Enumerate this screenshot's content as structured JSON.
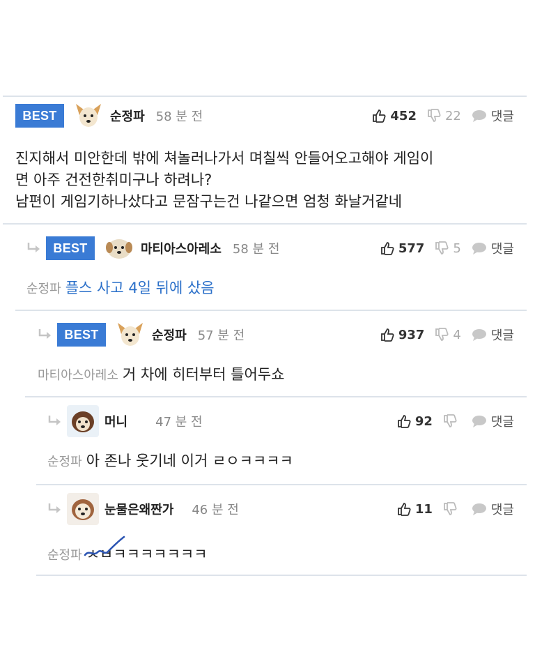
{
  "comments": [
    {
      "best": "BEST",
      "author": "순정파",
      "time": "58 분 전",
      "likes": "452",
      "dislikes": "22",
      "reply_label": "댓글",
      "body_lines": [
        "진지해서 미안한데 밖에 쳐놀러나가서 며칠씩 안들어오고해야 게임이",
        "면 아주 건전한취미구나 하려나?",
        "남편이 게임기하나샀다고 문잠구는건 나같으면 엄청 화날거같네"
      ]
    },
    {
      "best": "BEST",
      "author": "마티아스아레소",
      "time": "58 분 전",
      "likes": "577",
      "dislikes": "5",
      "reply_label": "댓글",
      "mention": "순정파",
      "body": "플스 사고 4일 뒤에 샀음"
    },
    {
      "best": "BEST",
      "author": "순정파",
      "time": "57 분 전",
      "likes": "937",
      "dislikes": "4",
      "reply_label": "댓글",
      "mention": "마티아스아레소",
      "body": "거 차에 히터부터 틀어두쇼"
    },
    {
      "author": "머니",
      "time": "47 분 전",
      "likes": "92",
      "dislikes": "",
      "reply_label": "댓글",
      "mention": "순정파",
      "body": "아 존나 웃기네 이거 ㄹㅇㅋㅋㅋㅋ"
    },
    {
      "author": "눈물은왜짠가",
      "time": "46 분 전",
      "likes": "11",
      "dislikes": "",
      "reply_label": "댓글",
      "mention": "순정파",
      "body": "ㅅㅂㅋㅋㅋㅋㅋㅋㅋ"
    }
  ],
  "colors": {
    "best_badge": "#3a7bd5",
    "mention_link": "#2a6fc9",
    "divider": "#dde3ea"
  },
  "icons": [
    "reply-arrow-icon",
    "dog-avatar-icon",
    "thumbs-up-icon",
    "thumbs-down-icon",
    "speech-bubble-icon"
  ]
}
